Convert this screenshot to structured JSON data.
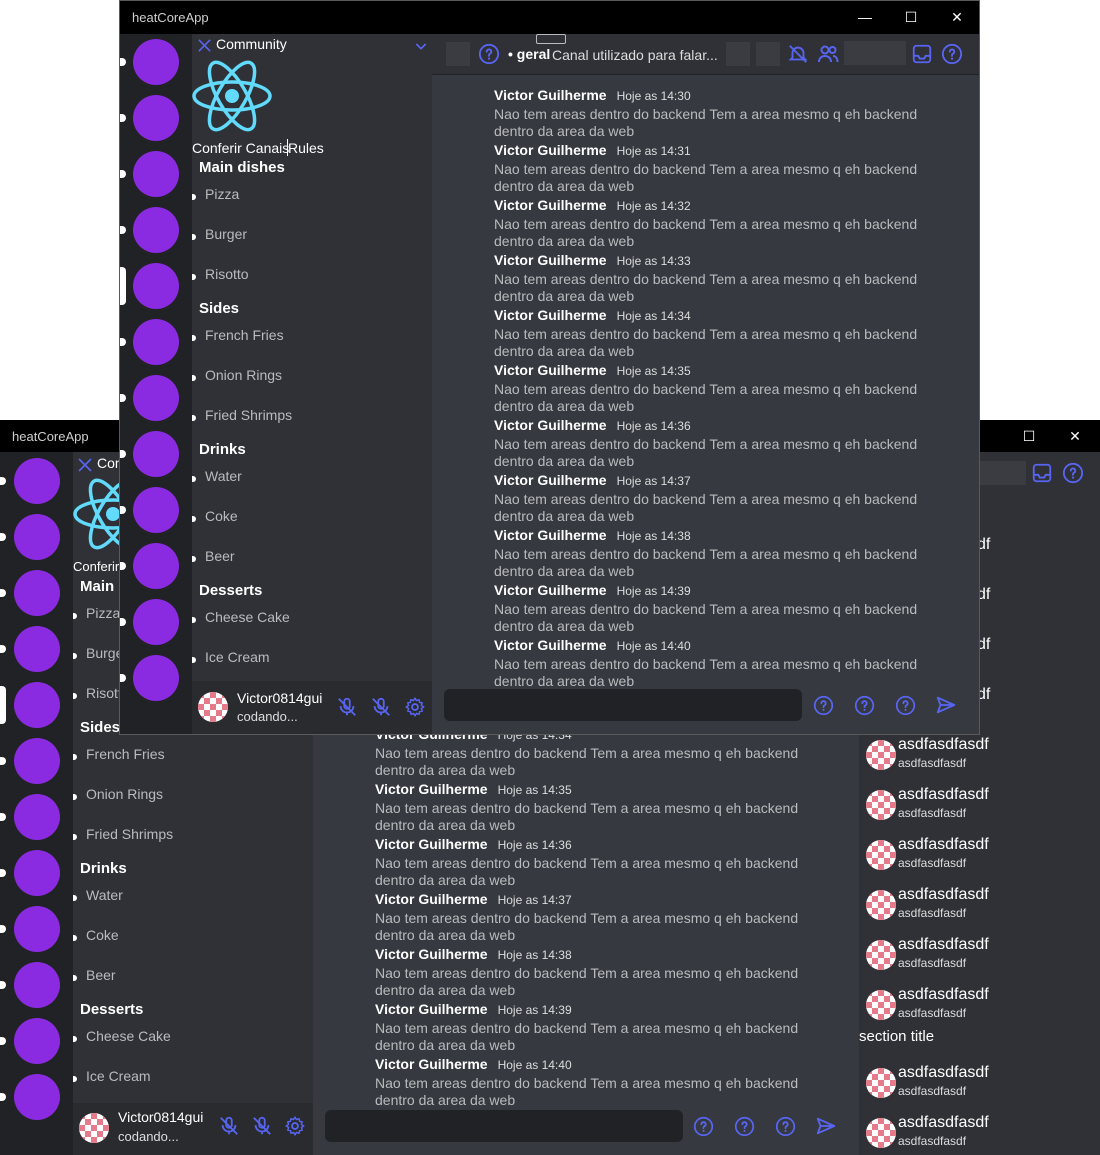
{
  "app_title": "heatCoreApp",
  "window_controls": {
    "minimize": "—",
    "maximize": "☐",
    "close": "✕"
  },
  "server": {
    "name": "Community",
    "logo_icon": "react-logo-icon",
    "button_left": "Conferir Canais",
    "button_right": "Rules"
  },
  "categories": [
    {
      "name": "Main dishes",
      "channels": [
        "Pizza",
        "Burger",
        "Risotto"
      ]
    },
    {
      "name": "Sides",
      "channels": [
        "French Fries",
        "Onion Rings",
        "Fried Shrimps"
      ]
    },
    {
      "name": "Drinks",
      "channels": [
        "Water",
        "Coke",
        "Beer"
      ]
    },
    {
      "name": "Desserts",
      "channels": [
        "Cheese Cake",
        "Ice Cream"
      ]
    }
  ],
  "channel_header": {
    "prefix": "• geral",
    "topic": "Canal utilizado para falar..."
  },
  "user": {
    "name": "Victor0814gui",
    "status": "codando..."
  },
  "messages": [
    {
      "author": "Victor Guilherme",
      "time": "Hoje as 14:30",
      "text": "Nao tem areas dentro do backend Tem a area mesmo q eh backend dentro da area da web"
    },
    {
      "author": "Victor Guilherme",
      "time": "Hoje as 14:31",
      "text": "Nao tem areas dentro do backend Tem a area mesmo q eh backend dentro da area da web"
    },
    {
      "author": "Victor Guilherme",
      "time": "Hoje as 14:32",
      "text": "Nao tem areas dentro do backend Tem a area mesmo q eh backend dentro da area da web"
    },
    {
      "author": "Victor Guilherme",
      "time": "Hoje as 14:33",
      "text": "Nao tem areas dentro do backend Tem a area mesmo q eh backend dentro da area da web"
    },
    {
      "author": "Victor Guilherme",
      "time": "Hoje as 14:34",
      "text": "Nao tem areas dentro do backend Tem a area mesmo q eh backend dentro da area da web"
    },
    {
      "author": "Victor Guilherme",
      "time": "Hoje as 14:35",
      "text": "Nao tem areas dentro do backend Tem a area mesmo q eh backend dentro da area da web"
    },
    {
      "author": "Victor Guilherme",
      "time": "Hoje as 14:36",
      "text": "Nao tem areas dentro do backend Tem a area mesmo q eh backend dentro da area da web"
    },
    {
      "author": "Victor Guilherme",
      "time": "Hoje as 14:37",
      "text": "Nao tem areas dentro do backend Tem a area mesmo q eh backend dentro da area da web"
    },
    {
      "author": "Victor Guilherme",
      "time": "Hoje as 14:38",
      "text": "Nao tem areas dentro do backend Tem a area mesmo q eh backend dentro da area da web"
    },
    {
      "author": "Victor Guilherme",
      "time": "Hoje as 14:39",
      "text": "Nao tem areas dentro do backend Tem a area mesmo q eh backend dentro da area da web"
    },
    {
      "author": "Victor Guilherme",
      "time": "Hoje as 14:40",
      "text": "Nao tem areas dentro do backend Tem a area mesmo q eh backend dentro da area da web"
    }
  ],
  "members": {
    "entries": [
      {
        "name": "asdfasdfasdf",
        "status": "asdfasdfasdf"
      },
      {
        "name": "asdfasdfasdf",
        "status": "asdfasdfasdf"
      },
      {
        "name": "asdfasdfasdf",
        "status": "asdfasdfasdf"
      },
      {
        "name": "asdfasdfasdf",
        "status": "asdfasdfasdf"
      },
      {
        "name": "asdfasdfasdf",
        "status": "asdfasdfasdf"
      },
      {
        "name": "asdfasdfasdf",
        "status": "asdfasdfasdf"
      }
    ],
    "partial_names": [
      "df",
      "df",
      "df",
      "df"
    ],
    "section_title": "section title",
    "after_section": [
      {
        "name": "asdfasdfasdf",
        "status": "asdfasdfasdf"
      },
      {
        "name": "asdfasdfasdf",
        "status": "asdfasdfasdf"
      }
    ]
  },
  "colors": {
    "accent": "#5865f2",
    "server_pill": "#8a2be2",
    "react": "#61dafb",
    "avatar": "#e57a8a"
  },
  "icons": {
    "header_left": "help-circle-icon",
    "mute": "bell-off-icon",
    "members": "members-icon",
    "inbox": "inbox-icon",
    "help": "help-circle-icon",
    "mic_off": "mic-off-icon",
    "headset_off": "headset-off-icon",
    "settings": "gear-icon",
    "send": "send-icon",
    "close_sidebar": "close-icon",
    "dropdown": "chevron-down-icon"
  }
}
